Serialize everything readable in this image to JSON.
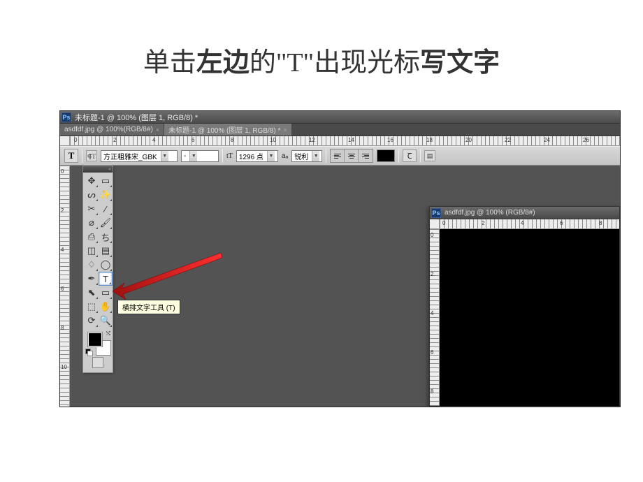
{
  "slide": {
    "title_p1": "单击",
    "title_p2": "左边",
    "title_p3": "的\"T\"出现光标",
    "title_p4": "写文字"
  },
  "window": {
    "title": "未标题-1 @ 100% (图层 1, RGB/8) *",
    "ps_badge": "Ps"
  },
  "tabs": [
    {
      "label": "asdfdf.jpg @ 100%(RGB/8#)",
      "active": false
    },
    {
      "label": "未标题-1 @ 100% (图层 1, RGB/8) *",
      "active": true
    }
  ],
  "options": {
    "tool_glyph": "T",
    "orientation_glyph": "⸿T",
    "font_family": "方正粗雅宋_GBK",
    "font_style": "-",
    "size_icon": "tT",
    "font_size": "1296 点",
    "aa_label": "aₐ",
    "aa_mode": "锐利",
    "color_swatch": "#000000"
  },
  "ruler_top": [
    "0",
    "2",
    "4",
    "6",
    "8",
    "10",
    "12",
    "14",
    "16",
    "18",
    "20",
    "22",
    "24",
    "26"
  ],
  "ruler_left": [
    "0",
    "2",
    "4",
    "6",
    "8",
    "10"
  ],
  "toolbox": {
    "tools": [
      {
        "name": "move-tool",
        "glyph": "✥"
      },
      {
        "name": "marquee-tool",
        "glyph": "▭"
      },
      {
        "name": "lasso-tool",
        "glyph": "ᔕ"
      },
      {
        "name": "magic-wand-tool",
        "glyph": "✨"
      },
      {
        "name": "crop-tool",
        "glyph": "✂"
      },
      {
        "name": "eyedropper-tool",
        "glyph": "⁄"
      },
      {
        "name": "healing-brush-tool",
        "glyph": "⌀"
      },
      {
        "name": "brush-tool",
        "glyph": "🖌"
      },
      {
        "name": "clone-stamp-tool",
        "glyph": "⎙"
      },
      {
        "name": "history-brush-tool",
        "glyph": "ち"
      },
      {
        "name": "eraser-tool",
        "glyph": "◫"
      },
      {
        "name": "gradient-tool",
        "glyph": "▤"
      },
      {
        "name": "blur-tool",
        "glyph": "♢"
      },
      {
        "name": "dodge-tool",
        "glyph": "◯"
      },
      {
        "name": "pen-tool",
        "glyph": "✒"
      },
      {
        "name": "type-tool",
        "glyph": "T",
        "selected": true
      },
      {
        "name": "path-selection-tool",
        "glyph": "⬉"
      },
      {
        "name": "shape-tool",
        "glyph": "▭"
      },
      {
        "name": "3d-tool",
        "glyph": "⬚"
      },
      {
        "name": "hand-tool",
        "glyph": "✋"
      },
      {
        "name": "rotate-view-tool",
        "glyph": "⟳"
      },
      {
        "name": "zoom-tool",
        "glyph": "🔍"
      }
    ],
    "fg_color": "#000000",
    "bg_color": "#ffffff"
  },
  "tooltip": "横排文字工具 (T)",
  "float_doc": {
    "title": "asdfdf.jpg @ 100% (RGB/8#)",
    "ruler_top": [
      "0",
      "2",
      "4",
      "6",
      "8"
    ],
    "ruler_left": [
      "0",
      "2",
      "4",
      "6",
      "8"
    ]
  }
}
